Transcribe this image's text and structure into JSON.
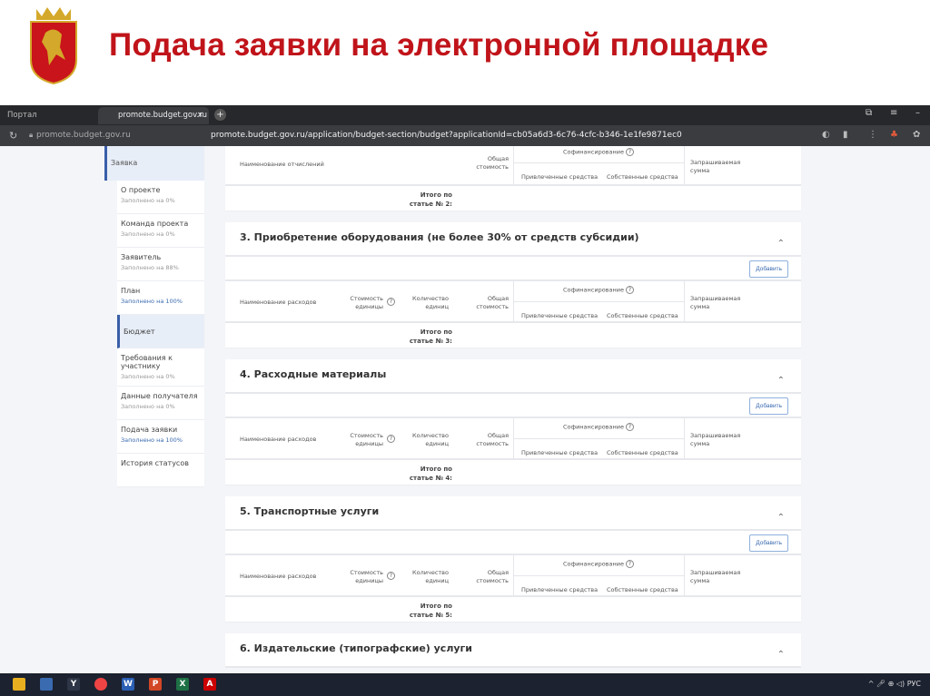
{
  "slide": {
    "title": "Подача заявки на электронной площадке"
  },
  "browser": {
    "tabs": [
      {
        "label": "Портал предоставлени"
      },
      {
        "label": "promote.budget.gov.ru"
      }
    ],
    "close_glyph": "×",
    "new_tab_glyph": "+",
    "host": "promote.budget.gov.ru",
    "url": "promote.budget.gov.ru/application/budget-section/budget?applicationId=cb05a6d3-6c76-4cfc-b346-1e1fe9871ec0"
  },
  "sidebar": {
    "top": "Заявка",
    "items": [
      {
        "label": "О проекте",
        "status": "Заполнено на 0%",
        "done": false
      },
      {
        "label": "Команда проекта",
        "status": "Заполнено на 0%",
        "done": false
      },
      {
        "label": "Заявитель",
        "status": "Заполнено на 88%",
        "done": false
      },
      {
        "label": "План",
        "status": "Заполнено на 100%",
        "done": true
      },
      {
        "label": "Бюджет",
        "status": "",
        "active": true
      },
      {
        "label": "Требования к участнику",
        "status": "Заполнено на 0%",
        "done": false
      },
      {
        "label": "Данные получателя",
        "status": "Заполнено на 0%",
        "done": false
      },
      {
        "label": "Подача заявки",
        "status": "Заполнено на 100%",
        "done": true
      },
      {
        "label": "История статусов",
        "status": ""
      }
    ]
  },
  "columns": {
    "name_deductions": "Наименование отчислений",
    "name_expenses": "Наименование расходов",
    "unit_cost": "Стоимость единицы",
    "quantity": "Количество единиц",
    "total_cost": "Общая стоимость",
    "cofinancing": "Софинансирование",
    "attracted": "Привлеченные средства",
    "own": "Собственные средства",
    "requested": "Запрашиваемая сумма",
    "help_glyph": "?"
  },
  "add_label": "Добавить",
  "section2_total": "Итого по статье № 2:",
  "sections": [
    {
      "title": "3. Приобретение оборудования (не более 30% от средств субсидии)",
      "total": "Итого по статье № 3:"
    },
    {
      "title": "4. Расходные материалы",
      "total": "Итого по статье № 4:"
    },
    {
      "title": "5. Транспортные услуги",
      "total": "Итого по статье № 5:"
    },
    {
      "title": "6. Издательские (типографские) услуги",
      "total": ""
    }
  ],
  "taskbar": {
    "lang": "РУС"
  }
}
